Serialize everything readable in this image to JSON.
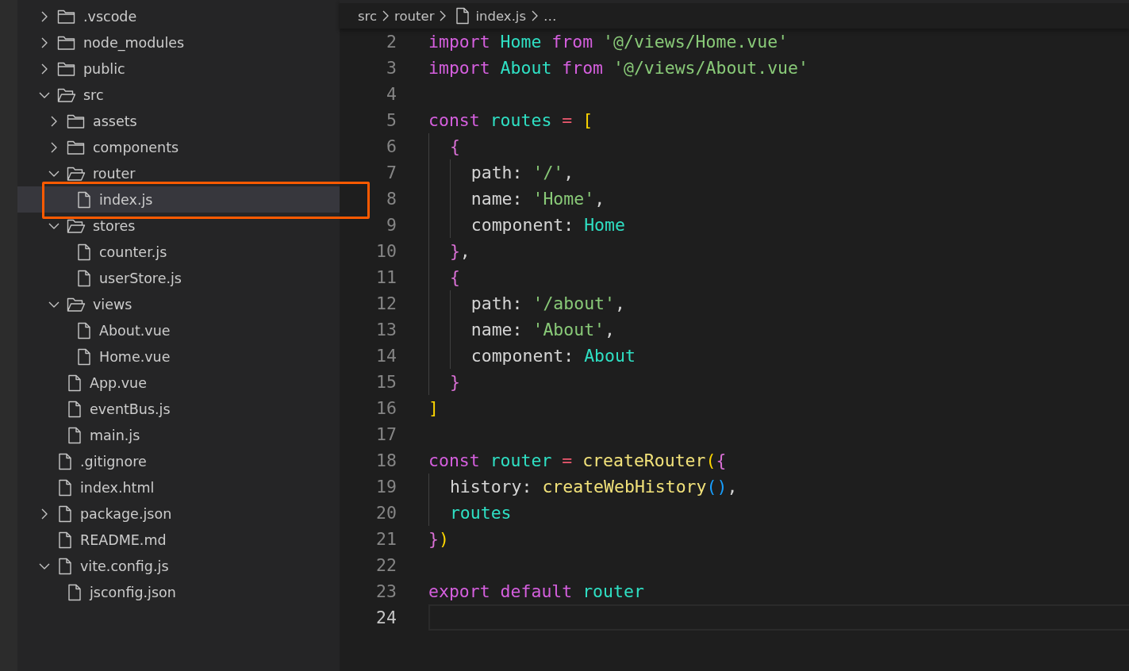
{
  "explorer": {
    "items": [
      {
        "label": ".vscode",
        "kind": "folder",
        "expanded": false,
        "selected": false
      },
      {
        "label": "node_modules",
        "kind": "folder",
        "expanded": false,
        "selected": false
      },
      {
        "label": "public",
        "kind": "folder",
        "expanded": false,
        "selected": false
      },
      {
        "label": "src",
        "kind": "folder",
        "expanded": true,
        "selected": false,
        "children": [
          {
            "label": "assets",
            "kind": "folder",
            "expanded": false,
            "selected": false
          },
          {
            "label": "components",
            "kind": "folder",
            "expanded": false,
            "selected": false
          },
          {
            "label": "router",
            "kind": "folder",
            "expanded": true,
            "selected": false,
            "children": [
              {
                "label": "index.js",
                "kind": "file",
                "selected": true,
                "highlighted": true
              }
            ]
          },
          {
            "label": "stores",
            "kind": "folder",
            "expanded": true,
            "selected": false,
            "children": [
              {
                "label": "counter.js",
                "kind": "file",
                "selected": false
              },
              {
                "label": "userStore.js",
                "kind": "file",
                "selected": false
              }
            ]
          },
          {
            "label": "views",
            "kind": "folder",
            "expanded": true,
            "selected": false,
            "children": [
              {
                "label": "About.vue",
                "kind": "file",
                "selected": false
              },
              {
                "label": "Home.vue",
                "kind": "file",
                "selected": false
              }
            ]
          },
          {
            "label": "App.vue",
            "kind": "file",
            "selected": false
          },
          {
            "label": "eventBus.js",
            "kind": "file",
            "selected": false
          },
          {
            "label": "main.js",
            "kind": "file",
            "selected": false
          }
        ]
      },
      {
        "label": ".gitignore",
        "kind": "file",
        "selected": false
      },
      {
        "label": "index.html",
        "kind": "file",
        "selected": false
      },
      {
        "label": "package.json",
        "kind": "file",
        "expanded": false,
        "selected": false
      },
      {
        "label": "README.md",
        "kind": "file",
        "selected": false
      },
      {
        "label": "vite.config.js",
        "kind": "file",
        "expanded": true,
        "selected": false,
        "children": [
          {
            "label": "jsconfig.json",
            "kind": "file",
            "selected": false
          }
        ]
      }
    ]
  },
  "breadcrumb": [
    {
      "label": "src",
      "kind": "folder"
    },
    {
      "label": "router",
      "kind": "folder"
    },
    {
      "label": "index.js",
      "kind": "file"
    },
    {
      "label": "…",
      "kind": "symbol"
    }
  ],
  "editor": {
    "lines": [
      {
        "number": "2",
        "current": false,
        "tokens": [
          {
            "text": "import ",
            "kind": "keyword"
          },
          {
            "text": "Home ",
            "kind": "variable"
          },
          {
            "text": "from ",
            "kind": "keyword"
          },
          {
            "text": "'@/views/Home.vue'",
            "kind": "string"
          }
        ]
      },
      {
        "number": "3",
        "current": false,
        "tokens": [
          {
            "text": "import ",
            "kind": "keyword"
          },
          {
            "text": "About ",
            "kind": "variable"
          },
          {
            "text": "from ",
            "kind": "keyword"
          },
          {
            "text": "'@/views/About.vue'",
            "kind": "string"
          }
        ]
      },
      {
        "number": "4",
        "current": false
      },
      {
        "number": "5",
        "current": false,
        "tokens": [
          {
            "text": "const ",
            "kind": "keyword"
          },
          {
            "text": "routes ",
            "kind": "variable"
          },
          {
            "text": "= ",
            "kind": "operator"
          },
          {
            "text": "[",
            "kind": "bracket1"
          }
        ]
      },
      {
        "number": "6",
        "current": false,
        "tokens": [
          {
            "text": "  {",
            "kind": "bracket2"
          }
        ]
      },
      {
        "number": "7",
        "current": false,
        "tokens": [
          {
            "text": "    path: ",
            "kind": "property"
          },
          {
            "text": "'/'",
            "kind": "string"
          },
          {
            "text": ",",
            "kind": "property"
          }
        ]
      },
      {
        "number": "8",
        "current": false,
        "tokens": [
          {
            "text": "    name: ",
            "kind": "property"
          },
          {
            "text": "'Home'",
            "kind": "string"
          },
          {
            "text": ",",
            "kind": "property"
          }
        ]
      },
      {
        "number": "9",
        "current": false,
        "tokens": [
          {
            "text": "    component: ",
            "kind": "property"
          },
          {
            "text": "Home",
            "kind": "variable"
          }
        ]
      },
      {
        "number": "10",
        "current": false,
        "tokens": [
          {
            "text": "  }",
            "kind": "bracket2"
          },
          {
            "text": ",",
            "kind": "property"
          }
        ]
      },
      {
        "number": "11",
        "current": false,
        "tokens": [
          {
            "text": "  {",
            "kind": "bracket2"
          }
        ]
      },
      {
        "number": "12",
        "current": false,
        "tokens": [
          {
            "text": "    path: ",
            "kind": "property"
          },
          {
            "text": "'/about'",
            "kind": "string"
          },
          {
            "text": ",",
            "kind": "property"
          }
        ]
      },
      {
        "number": "13",
        "current": false,
        "tokens": [
          {
            "text": "    name: ",
            "kind": "property"
          },
          {
            "text": "'About'",
            "kind": "string"
          },
          {
            "text": ",",
            "kind": "property"
          }
        ]
      },
      {
        "number": "14",
        "current": false,
        "tokens": [
          {
            "text": "    component: ",
            "kind": "property"
          },
          {
            "text": "About",
            "kind": "variable"
          }
        ]
      },
      {
        "number": "15",
        "current": false,
        "tokens": [
          {
            "text": "  }",
            "kind": "bracket2"
          }
        ]
      },
      {
        "number": "16",
        "current": false,
        "tokens": [
          {
            "text": "]",
            "kind": "bracket1"
          }
        ]
      },
      {
        "number": "17",
        "current": false
      },
      {
        "number": "18",
        "current": false,
        "tokens": [
          {
            "text": "const ",
            "kind": "keyword"
          },
          {
            "text": "router ",
            "kind": "variable"
          },
          {
            "text": "= ",
            "kind": "operator"
          },
          {
            "text": "createRouter",
            "kind": "function"
          },
          {
            "text": "(",
            "kind": "bracket1"
          },
          {
            "text": "{",
            "kind": "bracket2"
          }
        ]
      },
      {
        "number": "19",
        "current": false,
        "tokens": [
          {
            "text": "  history: ",
            "kind": "property"
          },
          {
            "text": "createWebHistory",
            "kind": "function"
          },
          {
            "text": "()",
            "kind": "bracket3"
          },
          {
            "text": ",",
            "kind": "property"
          }
        ]
      },
      {
        "number": "20",
        "current": false,
        "tokens": [
          {
            "text": "  routes",
            "kind": "variable"
          }
        ]
      },
      {
        "number": "21",
        "current": false,
        "tokens": [
          {
            "text": "}",
            "kind": "bracket2"
          },
          {
            "text": ")",
            "kind": "bracket1"
          }
        ]
      },
      {
        "number": "22",
        "current": false
      },
      {
        "number": "23",
        "current": false,
        "tokens": [
          {
            "text": "export ",
            "kind": "keyword"
          },
          {
            "text": "default ",
            "kind": "keyword"
          },
          {
            "text": "router",
            "kind": "variable"
          }
        ]
      },
      {
        "number": "24",
        "current": true
      }
    ]
  }
}
